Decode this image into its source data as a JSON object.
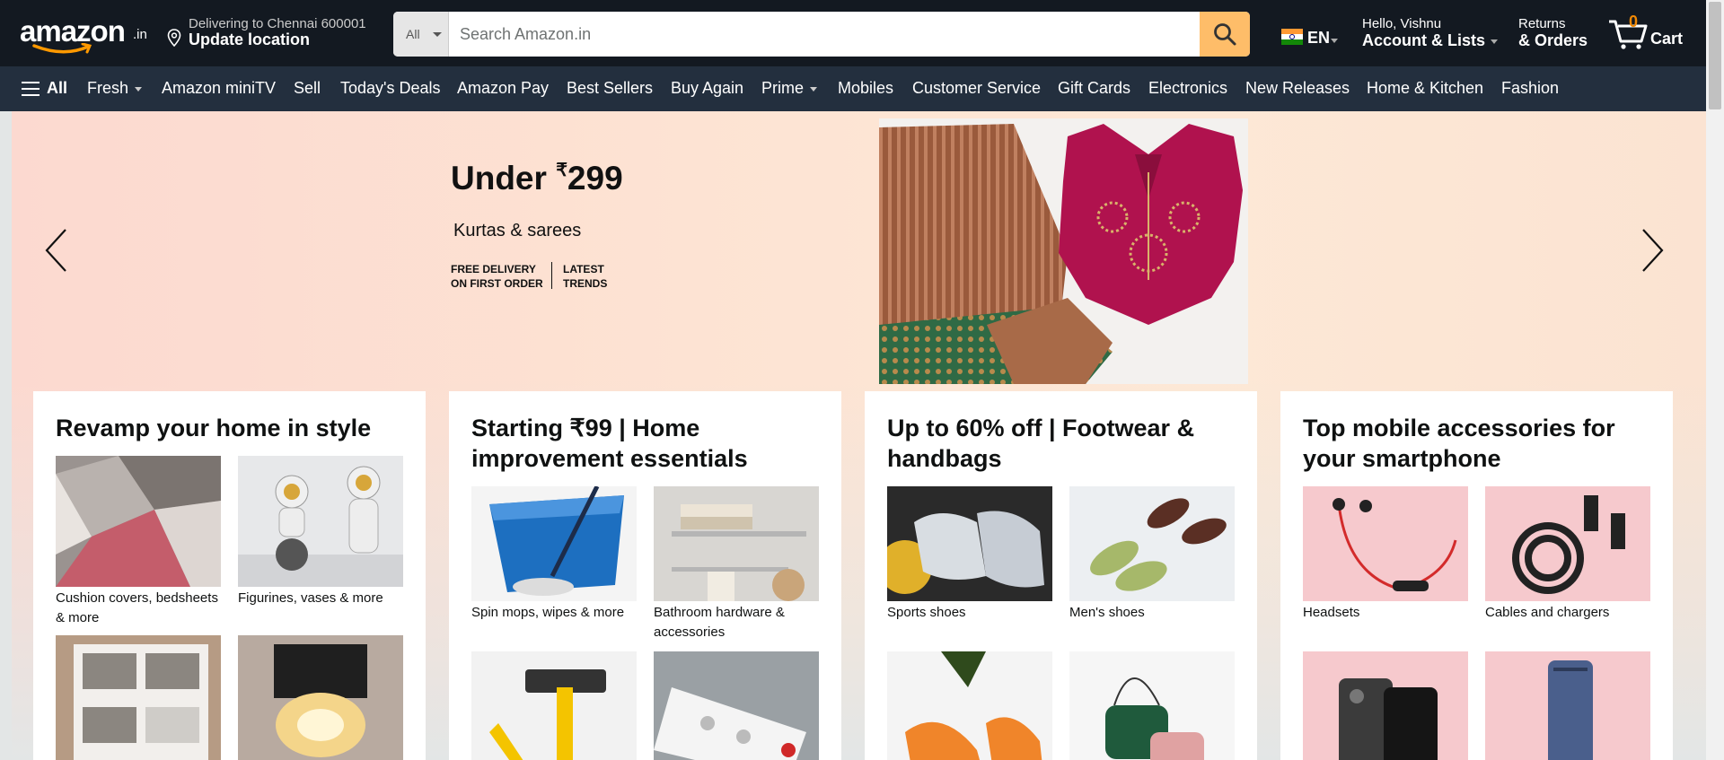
{
  "header": {
    "logo_text": "amazon",
    "logo_suffix": ".in",
    "location_line1": "Delivering to Chennai 600001",
    "location_line2": "Update location",
    "search_category": "All",
    "search_placeholder": "Search Amazon.in",
    "language": "EN",
    "account_line1": "Hello, Vishnu",
    "account_line2": "Account & Lists",
    "returns_line1": "Returns",
    "returns_line2": "& Orders",
    "cart_count": "0",
    "cart_label": "Cart"
  },
  "nav": {
    "all_label": "All",
    "items": [
      {
        "label": "Fresh"
      },
      {
        "label": "Amazon miniTV"
      },
      {
        "label": "Sell"
      },
      {
        "label": "Today's Deals"
      },
      {
        "label": "Amazon Pay"
      },
      {
        "label": "Best Sellers"
      },
      {
        "label": "Buy Again"
      },
      {
        "label": "Prime"
      },
      {
        "label": "Mobiles"
      },
      {
        "label": "Customer Service"
      },
      {
        "label": "Gift Cards"
      },
      {
        "label": "Electronics"
      },
      {
        "label": "New Releases"
      },
      {
        "label": "Home & Kitchen"
      },
      {
        "label": "Fashion"
      }
    ]
  },
  "hero": {
    "title": "Under ",
    "currency": "₹",
    "price": "299",
    "subtitle": "Kurtas & sarees",
    "feature1_line1": "FREE DELIVERY",
    "feature1_line2": "ON FIRST ORDER",
    "feature2_line1": "LATEST",
    "feature2_line2": "TRENDS"
  },
  "cards": [
    {
      "title": "Revamp your home in style",
      "tiles": [
        {
          "label": "Cushion covers, bedsheets & more"
        },
        {
          "label": "Figurines, vases & more"
        }
      ]
    },
    {
      "title": "Starting ₹99 | Home improvement essentials",
      "tiles": [
        {
          "label": "Spin mops, wipes & more"
        },
        {
          "label": "Bathroom hardware & accessories"
        }
      ]
    },
    {
      "title": "Up to 60% off | Footwear & handbags",
      "tiles": [
        {
          "label": "Sports shoes"
        },
        {
          "label": "Men's shoes"
        }
      ]
    },
    {
      "title": "Top mobile accessories for your smartphone",
      "tiles": [
        {
          "label": "Headsets"
        },
        {
          "label": "Cables and chargers"
        }
      ]
    }
  ],
  "colors": {
    "header_bg": "#131921",
    "nav_bg": "#232f3e",
    "search_button": "#febd69",
    "cart_count": "#f08804"
  }
}
